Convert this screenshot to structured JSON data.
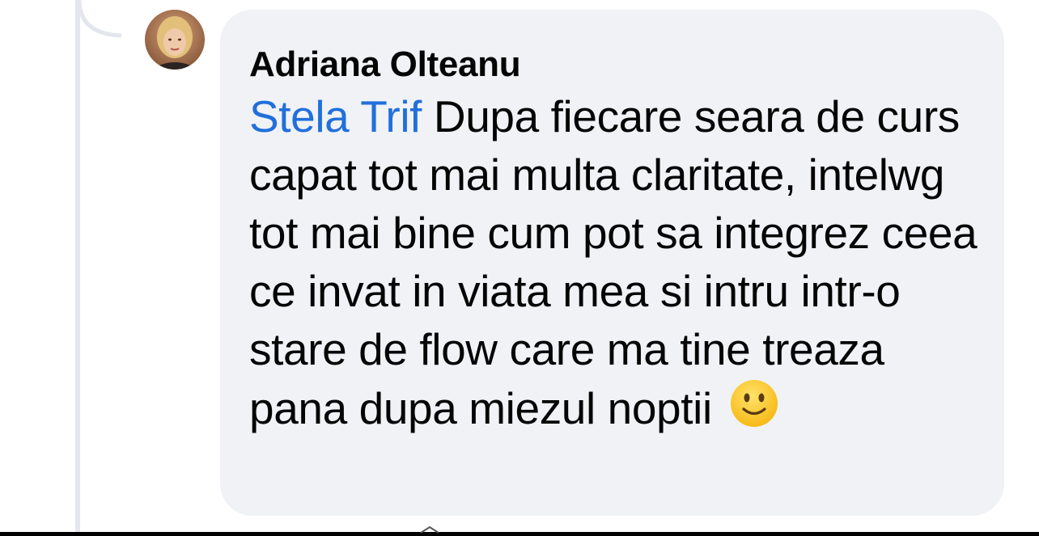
{
  "comment": {
    "author": "Adriana Olteanu",
    "mention": "Stela Trif",
    "text": " Dupa fiecare seara de curs capat tot mai multa claritate, intelwg tot mai bine cum pot sa integrez ceea ce invat in viata mea si intru intr-o stare de flow care ma tine treaza pana dupa miezul noptii",
    "emoji": "slightly-smiling-face-emoji"
  },
  "colors": {
    "bubble": "#f0f2f5",
    "mention": "#216fdb",
    "text": "#050505",
    "thread_line": "#e4e6ee"
  }
}
